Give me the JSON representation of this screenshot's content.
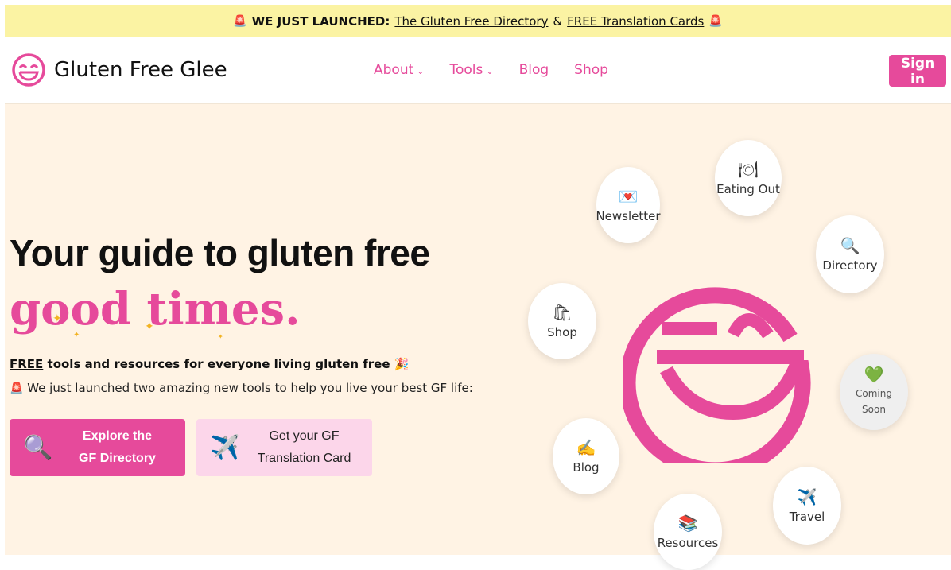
{
  "announcement": {
    "prefix": "WE JUST LAUNCHED:",
    "link1": "The Gluten Free Directory",
    "joiner": "&",
    "link2": "FREE Translation Cards"
  },
  "brand": {
    "name": "Gluten Free Glee",
    "color": "#e64a9b"
  },
  "nav": {
    "items": [
      {
        "label": "About",
        "dropdown": true
      },
      {
        "label": "Tools",
        "dropdown": true
      },
      {
        "label": "Blog",
        "dropdown": false
      },
      {
        "label": "Shop",
        "dropdown": false
      }
    ],
    "signin": "Sign in"
  },
  "hero": {
    "headline1": "Your guide to gluten free",
    "headline2": "good times.",
    "free_word": "FREE",
    "sub1_rest": "tools and resources for everyone living gluten free",
    "sub2": "We just launched two amazing new tools to help you live your best GF life:",
    "cta1_line1": "Explore the",
    "cta1_line2": "GF Directory",
    "cta2_line1": "Get your GF",
    "cta2_line2": "Translation Card"
  },
  "bubbles": {
    "newsletter": "Newsletter",
    "eating_out": "Eating Out",
    "directory": "Directory",
    "shop": "Shop",
    "coming1": "Coming",
    "coming2": "Soon",
    "blog": "Blog",
    "travel": "Travel",
    "resources": "Resources"
  },
  "icons": {
    "siren": "siren-icon",
    "search": "magnifier-icon",
    "plane": "airplane-icon",
    "party": "party-popper-icon"
  },
  "colors": {
    "accent": "#e64a9b",
    "announce_bg": "#fbf3a3",
    "hero_bg": "#fff3e4"
  }
}
